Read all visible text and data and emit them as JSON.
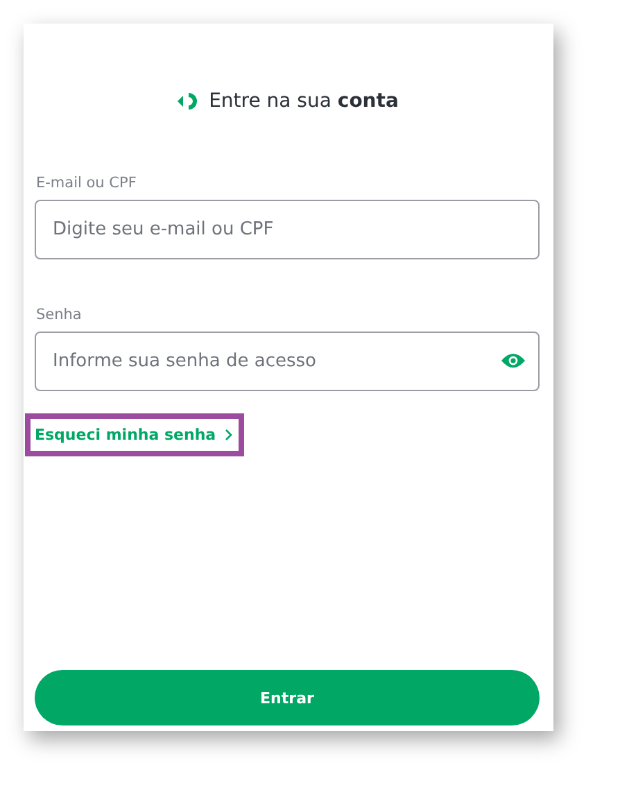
{
  "header": {
    "title": "Entre na sua **conta**"
  },
  "fields": [
    {
      "label": "E-mail ou CPF",
      "placeholder": "Digite seu e-mail ou CPF",
      "kind": "text"
    },
    {
      "label": "Senha",
      "placeholder": "Informe sua senha de acesso",
      "kind": "password"
    }
  ],
  "forgot_link": {
    "label": "Esqueci minha senha",
    "highlighted": true
  },
  "submit_button": {
    "label": "Entrar"
  }
}
